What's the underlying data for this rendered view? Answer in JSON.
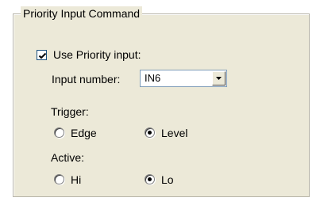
{
  "group": {
    "title": "Priority Input Command"
  },
  "use_priority": {
    "label": "Use Priority input:",
    "checked": true
  },
  "input_number": {
    "label": "Input number:",
    "value": "IN6"
  },
  "trigger": {
    "label": "Trigger:",
    "options": [
      {
        "label": "Edge",
        "selected": false
      },
      {
        "label": "Level",
        "selected": true
      }
    ]
  },
  "active": {
    "label": "Active:",
    "options": [
      {
        "label": "Hi",
        "selected": false
      },
      {
        "label": "Lo",
        "selected": true
      }
    ]
  },
  "icons": {
    "checkmark": "check-icon",
    "dropdown": "chevron-down-icon"
  }
}
